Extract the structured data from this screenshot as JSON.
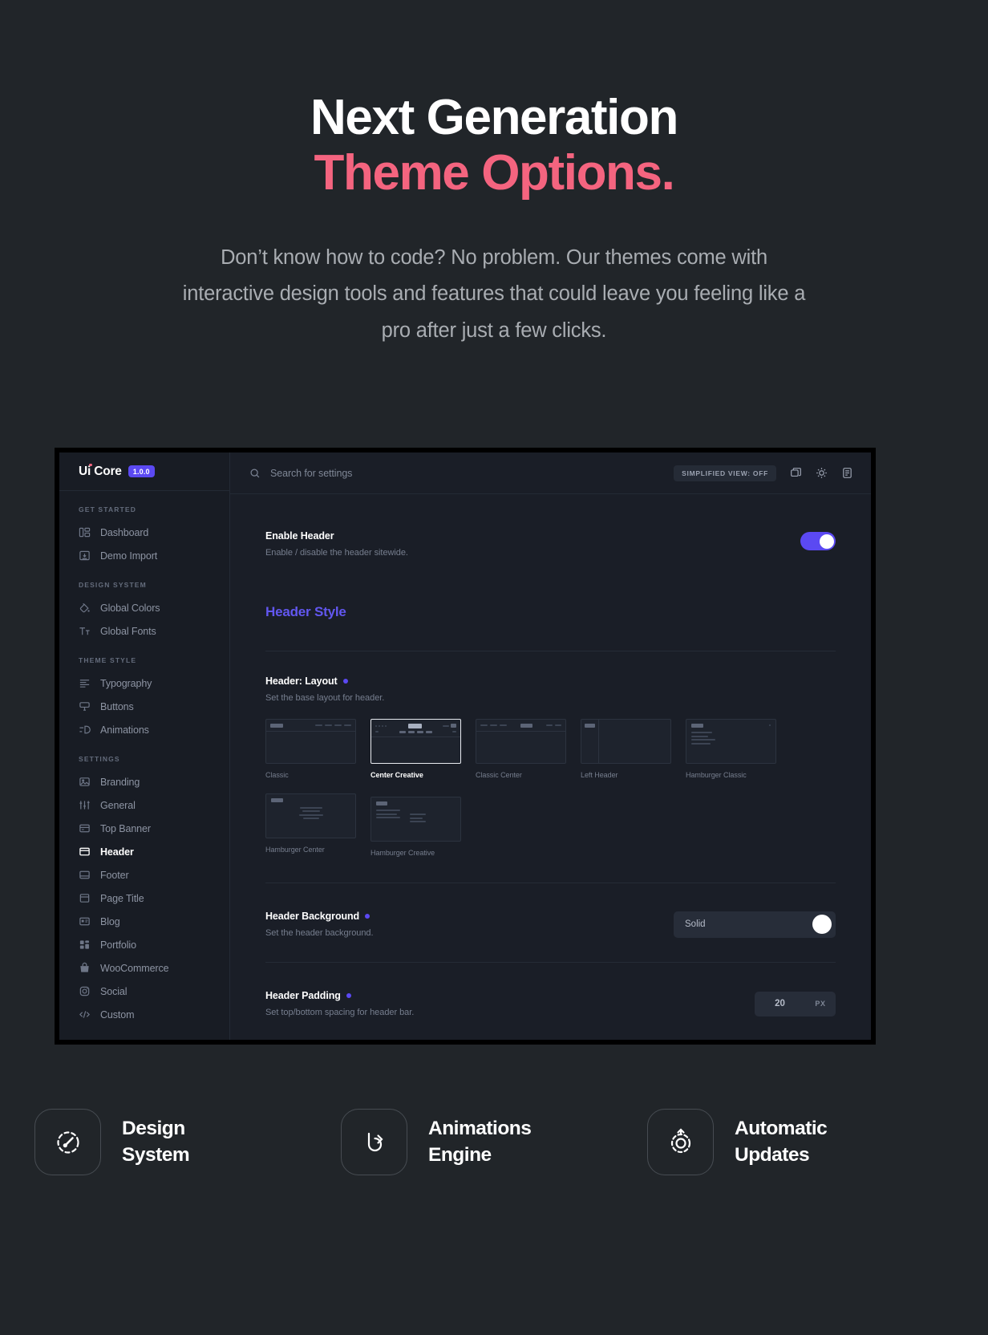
{
  "hero": {
    "title_line1": "Next Generation",
    "title_line2": "Theme Options.",
    "subtitle": "Don’t know how to code? No problem. Our themes come with interactive design tools and features that could leave you feeling like a pro after just a few clicks.",
    "accent_color": "#f4647f"
  },
  "app": {
    "brand": {
      "name": "Ui Core",
      "version": "1.0.0",
      "badge_color": "#5b49f2"
    },
    "topbar": {
      "search_placeholder": "Search for settings",
      "simplified_view": "SIMPLIFIED VIEW: OFF",
      "icons": [
        "layers-icon",
        "brightness-icon",
        "document-icon"
      ]
    },
    "sidebar": {
      "groups": [
        {
          "title": "GET STARTED",
          "items": [
            {
              "label": "Dashboard",
              "icon": "dashboard-icon",
              "active": false
            },
            {
              "label": "Demo Import",
              "icon": "demo-import-icon",
              "active": false
            }
          ]
        },
        {
          "title": "DESIGN SYSTEM",
          "items": [
            {
              "label": "Global Colors",
              "icon": "paint-bucket-icon",
              "active": false
            },
            {
              "label": "Global Fonts",
              "icon": "typography-icon",
              "active": false
            }
          ]
        },
        {
          "title": "THEME STYLE",
          "items": [
            {
              "label": "Typography",
              "icon": "text-lines-icon",
              "active": false
            },
            {
              "label": "Buttons",
              "icon": "button-icon",
              "active": false
            },
            {
              "label": "Animations",
              "icon": "animation-icon",
              "active": false
            }
          ]
        },
        {
          "title": "SETTINGS",
          "items": [
            {
              "label": "Branding",
              "icon": "image-icon",
              "active": false
            },
            {
              "label": "General",
              "icon": "sliders-icon",
              "active": false
            },
            {
              "label": "Top Banner",
              "icon": "top-banner-icon",
              "active": false
            },
            {
              "label": "Header",
              "icon": "header-icon",
              "active": true
            },
            {
              "label": "Footer",
              "icon": "footer-icon",
              "active": false
            },
            {
              "label": "Page Title",
              "icon": "page-title-icon",
              "active": false
            },
            {
              "label": "Blog",
              "icon": "blog-icon",
              "active": false
            },
            {
              "label": "Portfolio",
              "icon": "portfolio-icon",
              "active": false
            },
            {
              "label": "WooCommerce",
              "icon": "shop-bag-icon",
              "active": false
            },
            {
              "label": "Social",
              "icon": "instagram-icon",
              "active": false
            },
            {
              "label": "Custom",
              "icon": "code-icon",
              "active": false
            }
          ]
        }
      ]
    },
    "settings": {
      "enable_header": {
        "title": "Enable Header",
        "description": "Enable / disable the header sitewide.",
        "toggle_on": true
      },
      "section_title": "Header Style",
      "header_layout": {
        "title": "Header: Layout",
        "description": "Set the base layout for header.",
        "modified": true,
        "options": [
          {
            "label": "Classic",
            "selected": false
          },
          {
            "label": "Center Creative",
            "selected": true
          },
          {
            "label": "Classic Center",
            "selected": false
          },
          {
            "label": "Left Header",
            "selected": false
          },
          {
            "label": "Hamburger Classic",
            "selected": false
          },
          {
            "label": "Hamburger Center",
            "selected": false
          },
          {
            "label": "Hamburger Creative",
            "selected": false
          }
        ]
      },
      "header_background": {
        "title": "Header Background",
        "description": "Set the header background.",
        "modified": true,
        "value": "Solid",
        "swatch_color": "#ffffff"
      },
      "header_padding": {
        "title": "Header Padding",
        "description": "Set top/bottom spacing for header bar.",
        "modified": true,
        "value": "20",
        "unit": "PX"
      }
    }
  },
  "features": [
    {
      "label_line1": "Design",
      "label_line2": "System",
      "icon": "design-system-icon"
    },
    {
      "label_line1": "Animations",
      "label_line2": "Engine",
      "icon": "animations-engine-icon"
    },
    {
      "label_line1": "Automatic",
      "label_line2": "Updates",
      "icon": "automatic-updates-icon"
    }
  ]
}
